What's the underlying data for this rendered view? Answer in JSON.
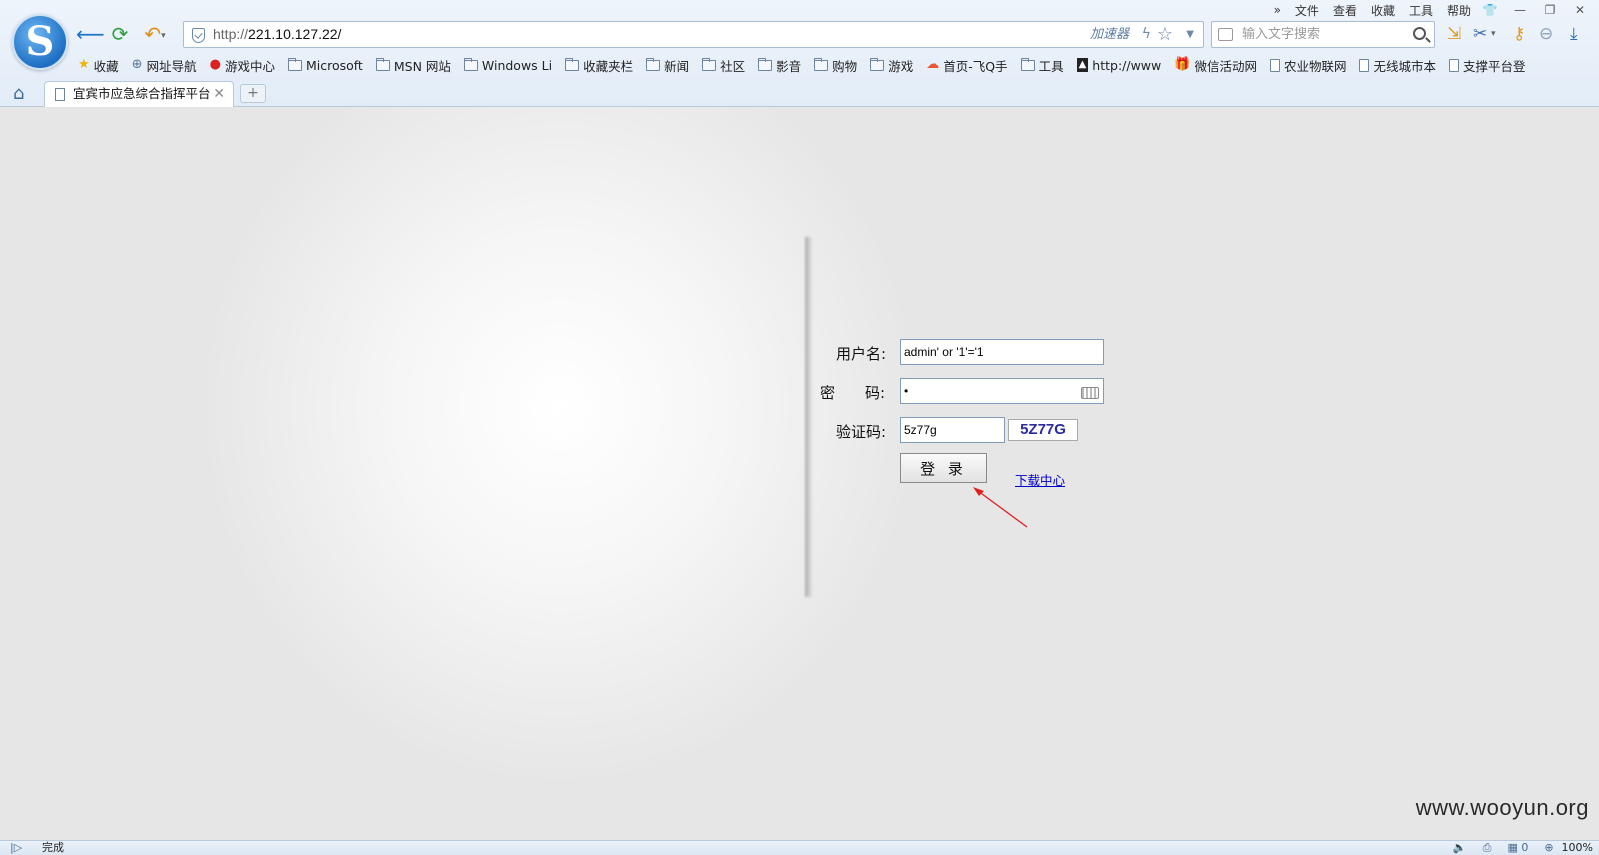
{
  "menu": {
    "more": "»",
    "items": [
      "文件",
      "查看",
      "收藏",
      "工具",
      "帮助"
    ]
  },
  "address_bar": {
    "url_prefix": "http://",
    "url_host": "221.10.127.22/",
    "accelerator": "加速器"
  },
  "search": {
    "placeholder": "输入文字搜索"
  },
  "bookmarks": [
    {
      "label": "收藏",
      "icon": "star-icon"
    },
    {
      "label": "网址导航",
      "icon": "globe-icon"
    },
    {
      "label": "游戏中心",
      "icon": "game-center-icon"
    },
    {
      "label": "Microsoft",
      "icon": "folder-icon"
    },
    {
      "label": "MSN 网站",
      "icon": "folder-icon"
    },
    {
      "label": "Windows Li",
      "icon": "folder-icon"
    },
    {
      "label": "收藏夹栏",
      "icon": "folder-icon"
    },
    {
      "label": "新闻",
      "icon": "folder-icon"
    },
    {
      "label": "社区",
      "icon": "folder-icon"
    },
    {
      "label": "影音",
      "icon": "folder-icon"
    },
    {
      "label": "购物",
      "icon": "folder-icon"
    },
    {
      "label": "游戏",
      "icon": "folder-icon"
    },
    {
      "label": "首页-飞Q手",
      "icon": "colorful-logo-icon"
    },
    {
      "label": "工具",
      "icon": "folder-icon"
    },
    {
      "label": "http://www",
      "icon": "dark-site-icon"
    },
    {
      "label": "微信活动网",
      "icon": "gift-icon"
    },
    {
      "label": "农业物联网",
      "icon": "page-icon"
    },
    {
      "label": "无线城市本",
      "icon": "page-icon"
    },
    {
      "label": "支撑平台登",
      "icon": "page-icon"
    }
  ],
  "tab": {
    "title": "宜宾市应急综合指挥平台",
    "new_tab": "+"
  },
  "login_form": {
    "username_label": "用户名:",
    "username_value": "admin' or '1'='1",
    "password_label": "密　　码:",
    "password_value": "•",
    "captcha_label": "验证码:",
    "captcha_value": "5z77g",
    "captcha_image_text": "5Z77G",
    "login_button": "登 录",
    "download_link": "下载中心"
  },
  "watermark": "www.wooyun.org",
  "status_bar": {
    "status": "完成",
    "count": "0",
    "zoom": "100%"
  },
  "colors": {
    "link": "#0000cc",
    "captcha_text": "#2b2b9e",
    "annotation_arrow": "#e02020"
  }
}
